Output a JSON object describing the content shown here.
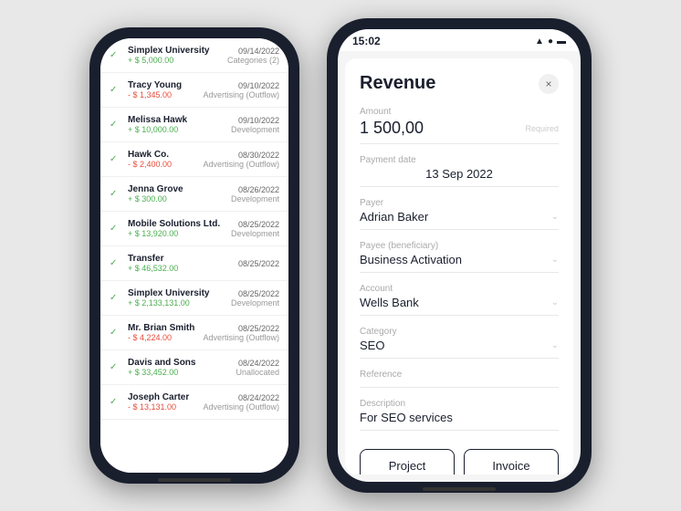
{
  "left_phone": {
    "transactions": [
      {
        "name": "Simplex University",
        "amount": "+ $ 5,000.00",
        "type": "positive",
        "date": "09/14/2022",
        "category": "Categories (2)",
        "checked": true
      },
      {
        "name": "Tracy Young",
        "amount": "- $ 1,345.00",
        "type": "negative",
        "date": "09/10/2022",
        "category": "Advertising (Outflow)",
        "checked": true
      },
      {
        "name": "Melissa Hawk",
        "amount": "+ $ 10,000.00",
        "type": "positive",
        "date": "09/10/2022",
        "category": "Development",
        "checked": true
      },
      {
        "name": "Hawk Co.",
        "amount": "- $ 2,400.00",
        "type": "negative",
        "date": "08/30/2022",
        "category": "Advertising (Outflow)",
        "checked": true
      },
      {
        "name": "Jenna Grove",
        "amount": "+ $ 300.00",
        "type": "positive",
        "date": "08/26/2022",
        "category": "Development",
        "checked": true
      },
      {
        "name": "Mobile Solutions Ltd.",
        "amount": "+ $ 13,920.00",
        "type": "positive",
        "date": "08/25/2022",
        "category": "Development",
        "checked": true
      },
      {
        "name": "Transfer",
        "amount": "+ $ 46,532.00",
        "type": "positive",
        "date": "08/25/2022",
        "category": "",
        "checked": true
      },
      {
        "name": "Simplex University",
        "amount": "+ $ 2,133,131.00",
        "type": "positive",
        "date": "08/25/2022",
        "category": "Development",
        "checked": true
      },
      {
        "name": "Mr. Brian Smith",
        "amount": "- $ 4,224.00",
        "type": "negative",
        "date": "08/25/2022",
        "category": "Advertising (Outflow)",
        "checked": true
      },
      {
        "name": "Davis and Sons",
        "amount": "+ $ 33,452.00",
        "type": "positive",
        "date": "08/24/2022",
        "category": "Unallocated",
        "checked": true
      },
      {
        "name": "Joseph Carter",
        "amount": "- $ 13,131.00",
        "type": "negative",
        "date": "08/24/2022",
        "category": "Advertising (Outflow)",
        "checked": true
      }
    ]
  },
  "right_phone": {
    "status_bar": {
      "time": "15:02",
      "icons": "▲ ●●●"
    },
    "modal": {
      "title": "Revenue",
      "close_label": "×",
      "fields": {
        "amount_label": "Amount",
        "amount_value": "1 500,00",
        "amount_required": "Required",
        "payment_date_label": "Payment date",
        "payment_date_value": "13 Sep 2022",
        "payer_label": "Payer",
        "payer_value": "Adrian Baker",
        "payee_label": "Payee (beneficiary)",
        "payee_value": "Business Activation",
        "account_label": "Account",
        "account_value": "Wells Bank",
        "category_label": "Category",
        "category_value": "SEO",
        "reference_label": "Reference",
        "reference_value": "",
        "description_label": "Description",
        "description_value": "For SEO services"
      },
      "footer": {
        "project_label": "Project",
        "invoice_label": "Invoice"
      }
    }
  }
}
